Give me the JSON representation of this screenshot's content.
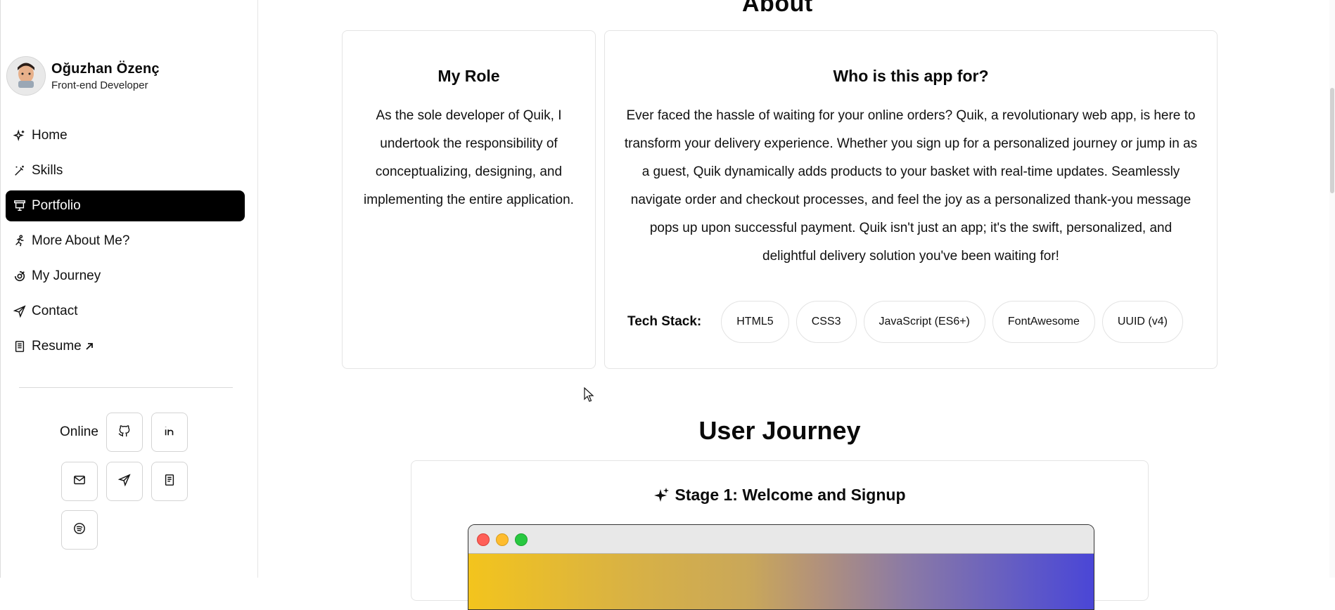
{
  "sidebar": {
    "profile": {
      "name": "Oğuzhan Özenç",
      "role": "Front-end Developer"
    },
    "nav": [
      {
        "label": "Home",
        "icon": "sparkle-icon"
      },
      {
        "label": "Skills",
        "icon": "wand-icon"
      },
      {
        "label": "Portfolio",
        "icon": "presentation-icon",
        "active": true
      },
      {
        "label": "More About Me?",
        "icon": "running-person-icon"
      },
      {
        "label": "My Journey",
        "icon": "journey-icon"
      },
      {
        "label": "Contact",
        "icon": "send-icon"
      },
      {
        "label": "Resume",
        "icon": "document-icon",
        "external": true
      }
    ],
    "online_label": "Online",
    "social": [
      "github-icon",
      "linkedin-icon",
      "mail-icon",
      "telegram-icon",
      "resume-icon",
      "spotify-icon"
    ]
  },
  "main": {
    "about_title": "About",
    "role_card": {
      "title": "My Role",
      "body": "As the sole developer of Quik, I undertook the responsibility of conceptualizing, designing, and implementing the entire application."
    },
    "audience_card": {
      "title": "Who is this app for?",
      "body": "Ever faced the hassle of waiting for your online orders? Quik, a revolutionary web app, is here to transform your delivery experience. Whether you sign up for a personalized journey or jump in as a guest, Quik dynamically adds products to your basket with real-time updates. Seamlessly navigate order and checkout processes, and feel the joy as a personalized thank-you message pops up upon successful payment. Quik isn't just an app; it's the swift, personalized, and delightful delivery solution you've been waiting for!",
      "tech_label": "Tech Stack:",
      "tech": [
        "HTML5",
        "CSS3",
        "JavaScript (ES6+)",
        "FontAwesome",
        "UUID (v4)"
      ]
    },
    "journey_title": "User Journey",
    "stage": {
      "title": "Stage 1: Welcome and Signup"
    }
  },
  "colors": {
    "active_nav_bg": "#000000",
    "mac_red": "#ff5f57",
    "mac_yellow": "#febc2e",
    "mac_green": "#28c840"
  }
}
